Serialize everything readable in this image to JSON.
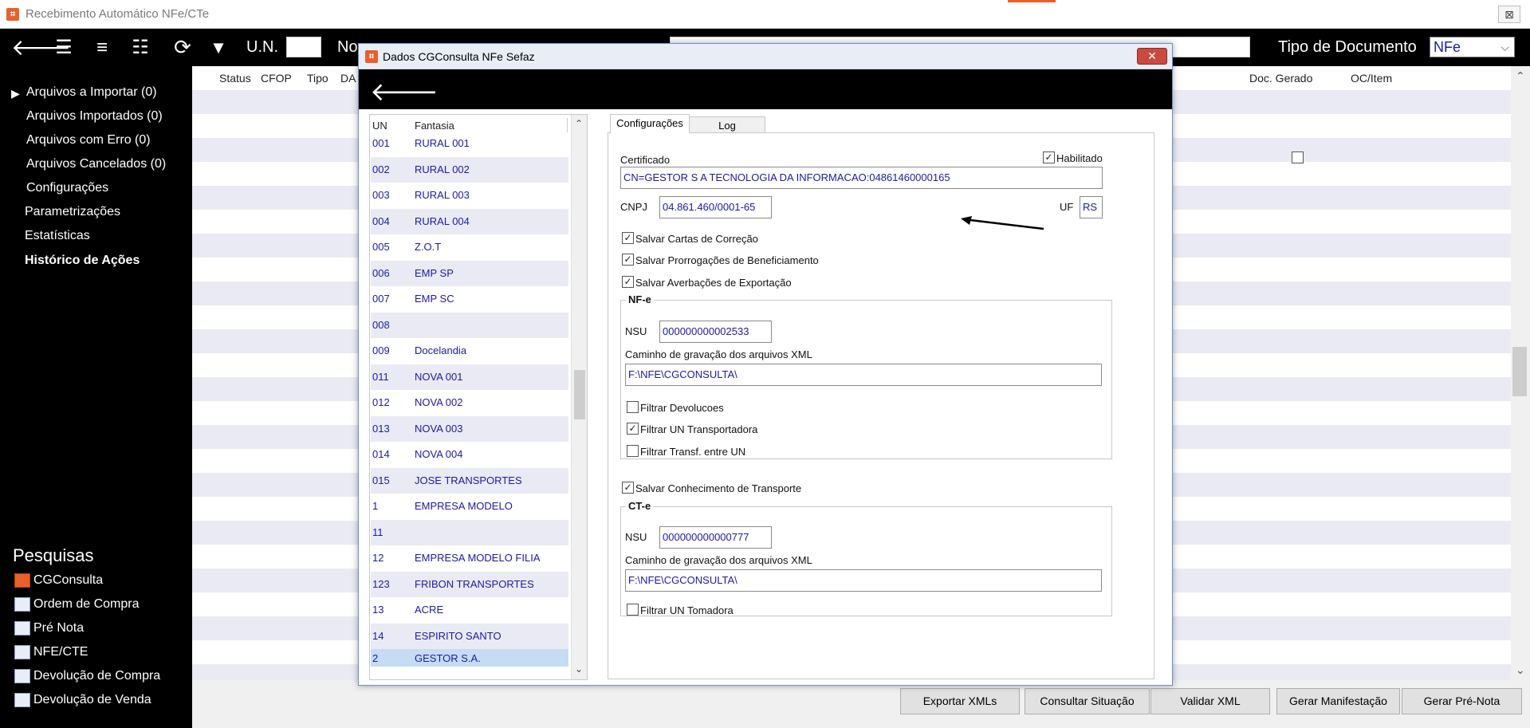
{
  "window": {
    "title": "Recebimento Automático NFe/CTe",
    "close_glyph": "⊠"
  },
  "toolbar": {
    "icons": [
      "back-arrow-icon",
      "checklist-icon",
      "list-icon",
      "checklist-gear-icon",
      "sync-icon",
      "filter-icon"
    ],
    "un_label": "U.N.",
    "nota_label": "No",
    "tipo_label": "Tipo de Documento",
    "tipo_value": "NFe"
  },
  "sidebar": {
    "items": [
      {
        "label": "Arquivos a Importar (0)"
      },
      {
        "label": "Arquivos Importados (0)"
      },
      {
        "label": "Arquivos com Erro (0)"
      },
      {
        "label": "Arquivos Cancelados (0)"
      },
      {
        "label": "Configurações"
      },
      {
        "label": "Parametrizações"
      },
      {
        "label": "Estatísticas"
      },
      {
        "label": "Histórico de Ações"
      }
    ],
    "pesquisas_title": "Pesquisas",
    "pesquisas": [
      {
        "label": "CGConsulta"
      },
      {
        "label": "Ordem de Compra"
      },
      {
        "label": "Pré Nota"
      },
      {
        "label": "NFE/CTE"
      },
      {
        "label": "Devolução de Compra"
      },
      {
        "label": "Devolução de Venda"
      }
    ]
  },
  "grid": {
    "columns": [
      "Status",
      "CFOP",
      "Tipo",
      "DA",
      "Doc. Gerado",
      "OC/Item"
    ]
  },
  "bottom_buttons": [
    {
      "label": "Exportar XMLs"
    },
    {
      "label": "Consultar Situação"
    },
    {
      "label": "Validar XML"
    },
    {
      "label": "Gerar Manifestação"
    },
    {
      "label": "Gerar Pré-Nota"
    }
  ],
  "dialog": {
    "title": "Dados CGConsulta NFe Sefaz",
    "close_glyph": "✕",
    "list": {
      "headers": [
        "UN",
        "Fantasia"
      ],
      "rows": [
        {
          "un": "001",
          "fantasia": "RURAL 001"
        },
        {
          "un": "002",
          "fantasia": "RURAL 002"
        },
        {
          "un": "003",
          "fantasia": "RURAL 003"
        },
        {
          "un": "004",
          "fantasia": "RURAL 004"
        },
        {
          "un": "005",
          "fantasia": "Z.O.T"
        },
        {
          "un": "006",
          "fantasia": "EMP SP"
        },
        {
          "un": "007",
          "fantasia": "EMP SC"
        },
        {
          "un": "008",
          "fantasia": ""
        },
        {
          "un": "009",
          "fantasia": "Docelandia"
        },
        {
          "un": "011",
          "fantasia": "NOVA 001"
        },
        {
          "un": "012",
          "fantasia": "NOVA 002"
        },
        {
          "un": "013",
          "fantasia": "NOVA 003"
        },
        {
          "un": "014",
          "fantasia": "NOVA 004"
        },
        {
          "un": "015",
          "fantasia": "JOSE TRANSPORTES"
        },
        {
          "un": "1",
          "fantasia": "EMPRESA MODELO"
        },
        {
          "un": "11",
          "fantasia": ""
        },
        {
          "un": "12",
          "fantasia": "EMPRESA MODELO FILIA"
        },
        {
          "un": "123",
          "fantasia": "FRIBON TRANSPORTES"
        },
        {
          "un": "13",
          "fantasia": "ACRE"
        },
        {
          "un": "14",
          "fantasia": "ESPIRITO SANTO"
        },
        {
          "un": "2",
          "fantasia": "GESTOR S.A."
        }
      ]
    },
    "tabs": [
      {
        "label": "Configurações"
      },
      {
        "label": "Log"
      }
    ],
    "config": {
      "certificado_label": "Certificado",
      "habilitado_label": "Habilitado",
      "habilitado_checked": true,
      "certificado_value": "CN=GESTOR S A TECNOLOGIA DA INFORMACAO:04861460000165",
      "cnpj_label": "CNPJ",
      "cnpj_value": "04.861.460/0001-65",
      "uf_label": "UF",
      "uf_value": "RS",
      "salvar_cartas": "Salvar Cartas de Correção",
      "salvar_prorrogacoes": "Salvar Prorrogações de Beneficiamento",
      "salvar_averbacoes": "Salvar Averbações de Exportação",
      "nfe_group": "NF-e",
      "nfe_nsu_label": "NSU",
      "nfe_nsu_value": "000000000002533",
      "nfe_caminho_label": "Caminho de gravação dos arquivos XML",
      "nfe_caminho_value": "F:\\NFE\\CGCONSULTA\\",
      "filtrar_devolucoes": "Filtrar Devolucoes",
      "filtrar_un_transp": "Filtrar UN Transportadora",
      "filtrar_transf": "Filtrar Transf. entre UN",
      "salvar_conhecimento": "Salvar Conhecimento de Transporte",
      "cte_group": "CT-e",
      "cte_nsu_label": "NSU",
      "cte_nsu_value": "000000000000777",
      "cte_caminho_label": "Caminho de gravação dos arquivos XML",
      "cte_caminho_value": "F:\\NFE\\CGCONSULTA\\",
      "filtrar_un_tomadora": "Filtrar UN Tomadora"
    }
  }
}
